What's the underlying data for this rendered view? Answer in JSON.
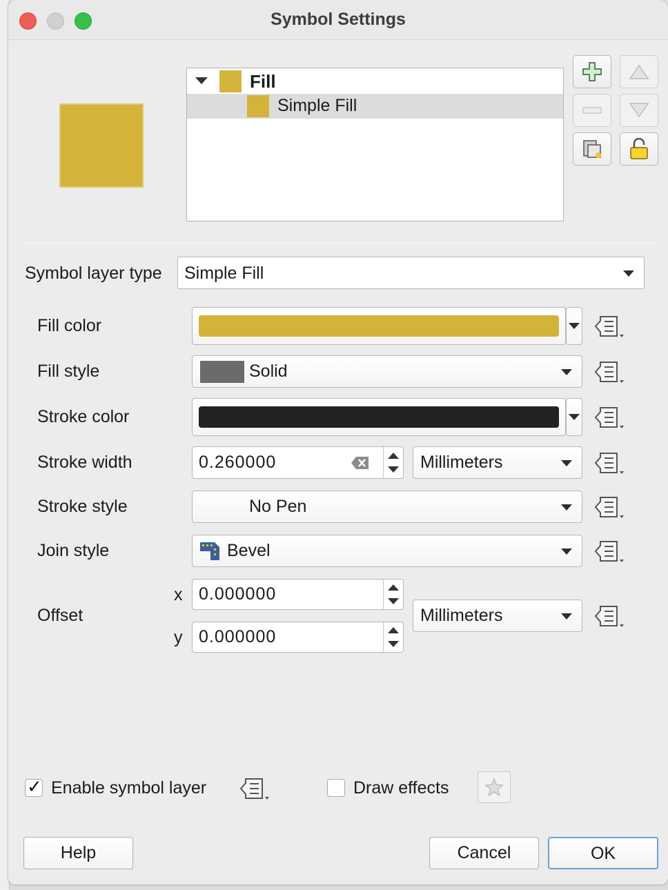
{
  "window": {
    "title": "Symbol Settings"
  },
  "tree": {
    "items": [
      {
        "label": "Fill"
      },
      {
        "label": "Simple Fill"
      }
    ]
  },
  "form": {
    "layer_type_label": "Symbol layer type",
    "layer_type_value": "Simple Fill",
    "fill_color_label": "Fill color",
    "fill_style_label": "Fill style",
    "fill_style_value": "Solid",
    "stroke_color_label": "Stroke color",
    "stroke_width_label": "Stroke width",
    "stroke_width_value": "0.260000",
    "stroke_width_unit": "Millimeters",
    "stroke_style_label": "Stroke style",
    "stroke_style_value": "No Pen",
    "join_style_label": "Join style",
    "join_style_value": "Bevel",
    "offset_label": "Offset",
    "offset_x_label": "x",
    "offset_x_value": "0.000000",
    "offset_y_label": "y",
    "offset_y_value": "0.000000",
    "offset_unit": "Millimeters"
  },
  "footer": {
    "enable_layer_label": "Enable symbol layer",
    "enable_layer_checked": true,
    "draw_effects_label": "Draw effects",
    "draw_effects_checked": false,
    "help_label": "Help",
    "cancel_label": "Cancel",
    "ok_label": "OK"
  },
  "colors": {
    "fill": "#d4b33a",
    "stroke": "#222222",
    "fill_style_swatch": "#6b6b6b",
    "ok_focus": "#6e9fd8"
  },
  "icons": {
    "add_layer": "plus-icon",
    "remove_layer": "minus-icon",
    "move_up": "arrow-up-icon",
    "move_down": "arrow-down-icon",
    "duplicate_layer": "duplicate-icon",
    "lock_layer": "unlock-icon",
    "data_defined": "data-defined-override-icon",
    "clear": "clear-icon",
    "join_style": "bevel-join-icon",
    "effects": "star-icon"
  }
}
